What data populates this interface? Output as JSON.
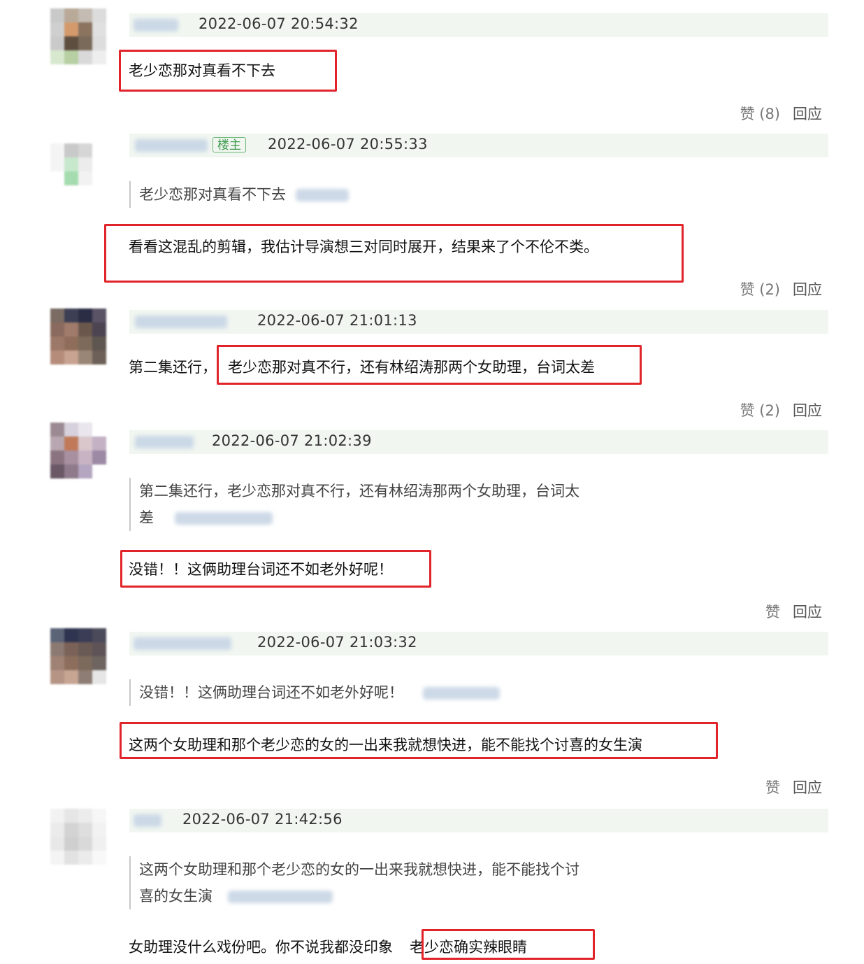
{
  "comments": [
    {
      "timestamp": "2022-06-07 20:54:32",
      "text": "老少恋那对真看不下去",
      "like": "赞 (8)",
      "reply": "回应"
    },
    {
      "timestamp": "2022-06-07 20:55:33",
      "op_tag": "楼主",
      "quote": "老少恋那对真看不下去",
      "text": "看看这混乱的剪辑，我估计导演想三对同时展开，结果来了个不伦不类。",
      "like": "赞 (2)",
      "reply": "回应"
    },
    {
      "timestamp": "2022-06-07 21:01:13",
      "text_prefix": "第二集还行，",
      "text": "老少恋那对真不行，还有林绍涛那两个女助理，台词太差",
      "like": "赞 (2)",
      "reply": "回应"
    },
    {
      "timestamp": "2022-06-07 21:02:39",
      "quote_line1": "第二集还行，老少恋那对真不行，还有林绍涛那两个女助理，台词太",
      "quote_line2": "差",
      "text": "没错！！这俩助理台词还不如老外好呢！",
      "like": "赞",
      "reply": "回应"
    },
    {
      "timestamp": "2022-06-07 21:03:32",
      "quote": "没错！！这俩助理台词还不如老外好呢！",
      "text": "这两个女助理和那个老少恋的女的一出来我就想快进，能不能找个讨喜的女生演",
      "like": "赞",
      "reply": "回应"
    },
    {
      "timestamp": "2022-06-07 21:42:56",
      "quote_line1": "这两个女助理和那个老少恋的女的一出来我就想快进，能不能找个讨",
      "quote_line2": "喜的女生演",
      "text_prefix": "女助理没什么戏份吧。你不说我都没印象",
      "text": "老少恋确实辣眼睛"
    }
  ],
  "colors": {
    "highlight_border": "#e0242a",
    "header_bg": "#f1f6f1",
    "op_tag": "#3f9b4f"
  }
}
